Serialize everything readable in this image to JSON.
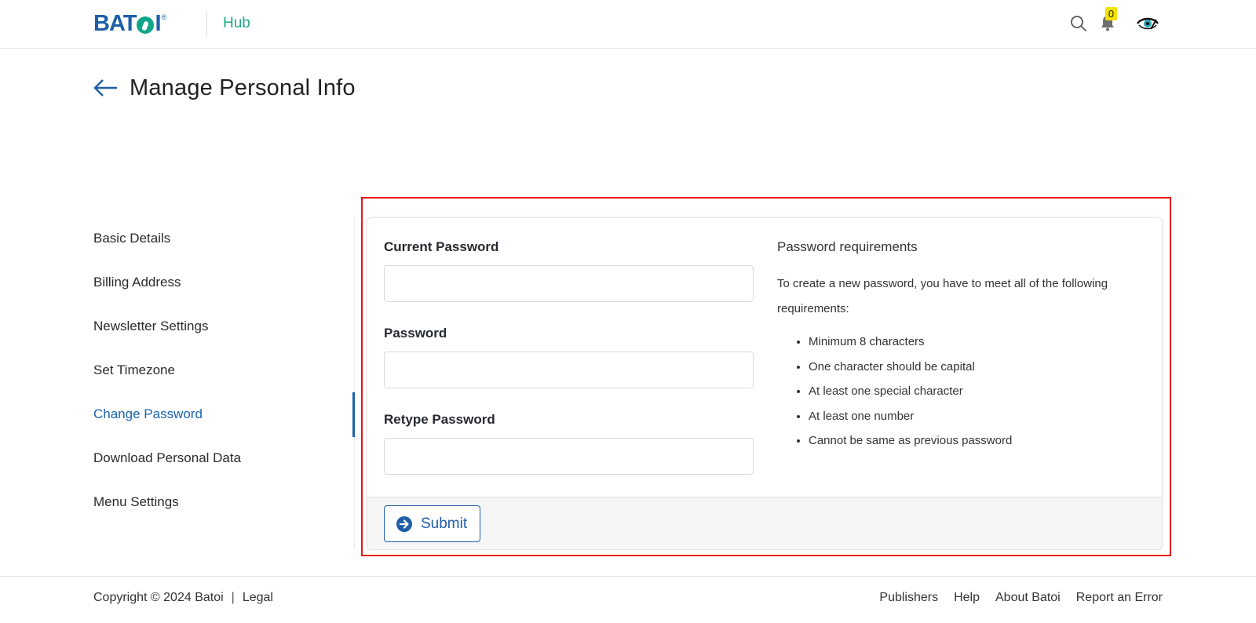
{
  "header": {
    "logo_text_left": "BAT",
    "logo_text_right": "I",
    "logo_registered": "®",
    "app_name": "Hub",
    "notification_count": "0",
    "icons": {
      "search": "search-icon",
      "notifications": "bell-icon",
      "profile": "eye-icon"
    },
    "colors": {
      "brand_blue": "#1f5ea8",
      "brand_green": "#12a689",
      "hub_green": "#22a88a",
      "badge_yellow": "#f5e200"
    }
  },
  "page": {
    "title": "Manage Personal Info",
    "back_icon": "arrow-left-icon"
  },
  "sidebar": {
    "active_color": "#1a63ad",
    "items": [
      {
        "label": "Basic Details",
        "active": false
      },
      {
        "label": "Billing Address",
        "active": false
      },
      {
        "label": "Newsletter Settings",
        "active": false
      },
      {
        "label": "Set Timezone",
        "active": false
      },
      {
        "label": "Change Password",
        "active": true
      },
      {
        "label": "Download Personal Data",
        "active": false
      },
      {
        "label": "Menu Settings",
        "active": false
      }
    ]
  },
  "form": {
    "fields": [
      {
        "label": "Current Password",
        "value": "",
        "placeholder": ""
      },
      {
        "label": "Password",
        "value": "",
        "placeholder": ""
      },
      {
        "label": "Retype Password",
        "value": "",
        "placeholder": ""
      }
    ],
    "submit_label": "Submit",
    "submit_icon": "arrow-circle-right-icon"
  },
  "requirements": {
    "title": "Password requirements",
    "intro": "To create a new password, you have to meet all of the following requirements:",
    "items": [
      "Minimum 8 characters",
      "One character should be capital",
      "At least one special character",
      "At least one number",
      "Cannot be same as previous password"
    ]
  },
  "footer": {
    "copyright": "Copyright © 2024 Batoi",
    "separator": "|",
    "legal": "Legal",
    "links": [
      "Publishers",
      "Help",
      "About Batoi",
      "Report an Error"
    ]
  },
  "highlight_color": "#e81414"
}
